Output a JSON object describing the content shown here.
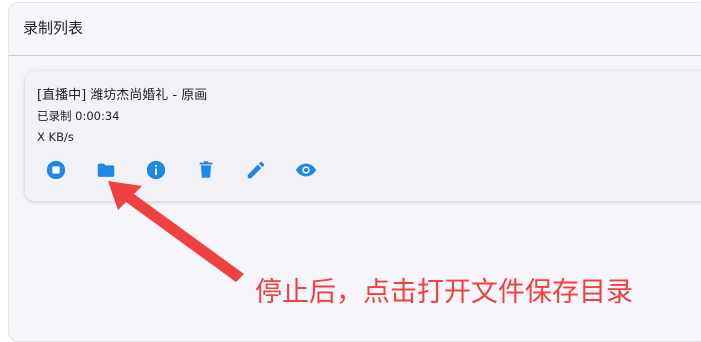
{
  "panel": {
    "title": "录制列表"
  },
  "recording": {
    "title": "[直播中] 潍坊杰尚婚礼 - 原画",
    "duration": "已录制 0:00:34",
    "speed": "X KB/s",
    "actions": [
      {
        "name": "stop",
        "icon": "stop-circle-icon"
      },
      {
        "name": "open-folder",
        "icon": "folder-icon"
      },
      {
        "name": "info",
        "icon": "info-icon"
      },
      {
        "name": "delete",
        "icon": "trash-icon"
      },
      {
        "name": "edit",
        "icon": "pencil-icon"
      },
      {
        "name": "preview",
        "icon": "eye-icon"
      }
    ]
  },
  "annotation": {
    "text": "停止后，点击打开文件保存目录"
  },
  "colors": {
    "accent": "#1e88e5",
    "annotation": "#f04040"
  }
}
